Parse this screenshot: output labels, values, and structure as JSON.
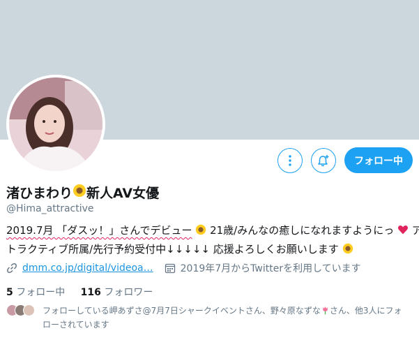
{
  "profile": {
    "display_name": "渚ひまわり",
    "name_suffix": "新人AV女優",
    "handle": "@Hima_attractive",
    "follow_button": "フォロー中",
    "bio_line1_underlined": "2019.7月 「ダスッ！」さんでデビュー",
    "bio_line1_rest": "21歳/みんなの癒しになれますようにっ",
    "bio_line1_end": "ア",
    "bio_line2": "トラクティブ所属/先行予約受付中↓↓↓↓↓ 応援よろしくお願いします",
    "link": "dmm.co.jp/digital/videoa…",
    "joined": "2019年7月からTwitterを利用しています",
    "following_count": "5",
    "following_label": "フォロー中",
    "followers_count": "116",
    "followers_label": "フォロワー",
    "known_followers_part1": "フォローしている岬あずさ@7月7日シャークイベントさん、野々原なずな",
    "known_followers_part2": "さん、他3人にフォローされています"
  },
  "colors": {
    "accent": "#1da1f2",
    "banner": "#ccd6dd",
    "secondary_text": "#657786",
    "underline": "#e0245e"
  },
  "icons": [
    "more-icon",
    "notification-add-icon",
    "link-icon",
    "calendar-icon",
    "sunflower-emoji",
    "heart-emoji",
    "tulip-emoji"
  ]
}
